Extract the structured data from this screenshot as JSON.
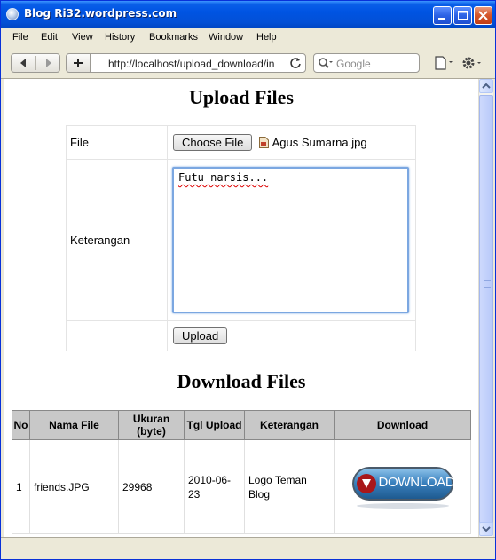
{
  "window": {
    "title": "Blog Ri32.wordpress.com"
  },
  "menu": [
    "File",
    "Edit",
    "View",
    "History",
    "Bookmarks",
    "Window",
    "Help"
  ],
  "toolbar": {
    "url": "http://localhost/upload_download/in",
    "search_placeholder": "Google"
  },
  "page": {
    "upload_heading": "Upload Files",
    "download_heading": "Download Files",
    "form": {
      "file_label": "File",
      "choose_button": "Choose File",
      "chosen_file": "Agus Sumarna.jpg",
      "keterangan_label": "Keterangan",
      "keterangan_value": "Futu narsis...",
      "upload_button": "Upload"
    },
    "downloads": {
      "headers": [
        "No",
        "Nama File",
        "Ukuran (byte)",
        "Tgl Upload",
        "Keterangan",
        "Download"
      ],
      "rows": [
        {
          "no": "1",
          "nama_file": "friends.JPG",
          "ukuran": "29968",
          "tgl_upload": "2010-06-23",
          "keterangan": "Logo Teman Blog",
          "download_label": "DOWNLOAD"
        }
      ]
    }
  },
  "colors": {
    "titlebar": "#0054e3",
    "download_button": "#2e6fa6",
    "textarea_focus": "#7ba7e1"
  }
}
